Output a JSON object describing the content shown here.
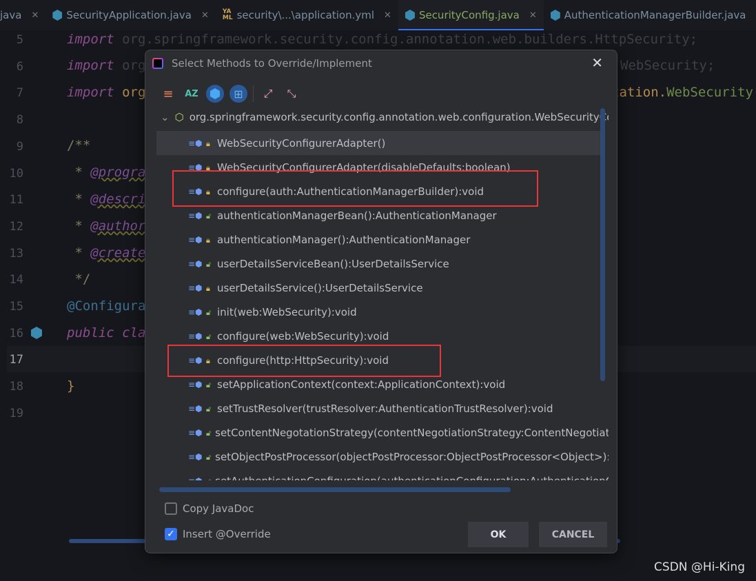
{
  "tabs": [
    {
      "label": "java",
      "icon": "java-file-icon"
    },
    {
      "label": "SecurityApplication.java",
      "icon": "class-icon"
    },
    {
      "label": "security\\...\\application.yml",
      "icon": "yaml-icon"
    },
    {
      "label": "SecurityConfig.java",
      "icon": "class-icon",
      "active": true
    },
    {
      "label": "AuthenticationManagerBuilder.java",
      "icon": "class-icon"
    }
  ],
  "editor": {
    "line_numbers": [
      "5",
      "6",
      "7",
      "8",
      "9",
      "10",
      "11",
      "12",
      "13",
      "14",
      "15",
      "16",
      "17",
      "18",
      "19"
    ],
    "current_line": "17",
    "lines": {
      "l5a": "import",
      "l5b": " org.springframework.security.config.annotation.web.builders.HttpSecurity;",
      "l6a": "import",
      "l6b": " org",
      "l6c": "WebSecurity;",
      "l7a": "import",
      "l7b": " org",
      "l7c": "tation.",
      "l7d": "WebSecurity(",
      "l9": "/**",
      "l10a": " * ",
      "l10b": "@progra",
      "l11a": " * ",
      "l11b": "@descri",
      "l12a": " * ",
      "l12b": "@author",
      "l13a": " * ",
      "l13b": "@create",
      "l14": " */",
      "l15": "@Configura",
      "l16": "public cla",
      "l18": "}"
    }
  },
  "dialog": {
    "title": "Select Methods to Override/Implement",
    "close": "✕",
    "toolbar": [
      "sort-by-visibility",
      "sort-alphabetically",
      "show-classes",
      "show-interfaces",
      "expand-all",
      "collapse-all"
    ],
    "tree_root": "org.springframework.security.config.annotation.web.configuration.WebSecurityConfigurerAdapter",
    "methods": [
      {
        "label": "WebSecurityConfigurerAdapter()",
        "access": "protected"
      },
      {
        "label": "WebSecurityConfigurerAdapter(disableDefaults:boolean)",
        "access": "protected"
      },
      {
        "label": "configure(auth:AuthenticationManagerBuilder):void",
        "access": "protected"
      },
      {
        "label": "authenticationManagerBean():AuthenticationManager",
        "access": "public"
      },
      {
        "label": "authenticationManager():AuthenticationManager",
        "access": "protected"
      },
      {
        "label": "userDetailsServiceBean():UserDetailsService",
        "access": "public"
      },
      {
        "label": "userDetailsService():UserDetailsService",
        "access": "protected"
      },
      {
        "label": "init(web:WebSecurity):void",
        "access": "public"
      },
      {
        "label": "configure(web:WebSecurity):void",
        "access": "public"
      },
      {
        "label": "configure(http:HttpSecurity):void",
        "access": "protected"
      },
      {
        "label": "setApplicationContext(context:ApplicationContext):void",
        "access": "public"
      },
      {
        "label": "setTrustResolver(trustResolver:AuthenticationTrustResolver):void",
        "access": "public"
      },
      {
        "label": "setContentNegotationStrategy(contentNegotiationStrategy:ContentNegotiationStrategy):void",
        "access": "public"
      },
      {
        "label": "setObjectPostProcessor(objectPostProcessor:ObjectPostProcessor<Object>):void",
        "access": "public"
      },
      {
        "label": "setAuthenticationConfiguration(authenticationConfiguration:AuthenticationConfiguration):void",
        "access": "public"
      }
    ],
    "selected_index": 0,
    "copy_javadoc": {
      "label": "Copy JavaDoc",
      "checked": false
    },
    "insert_override": {
      "label": "Insert @Override",
      "checked": true
    },
    "ok": "OK",
    "cancel": "CANCEL"
  },
  "watermark": "CSDN @Hi-King",
  "colors": {
    "accent": "#3574f0",
    "highlight_box": "#e8363a",
    "protected_lock": "#d9b656",
    "public_lock": "#8cc265"
  }
}
